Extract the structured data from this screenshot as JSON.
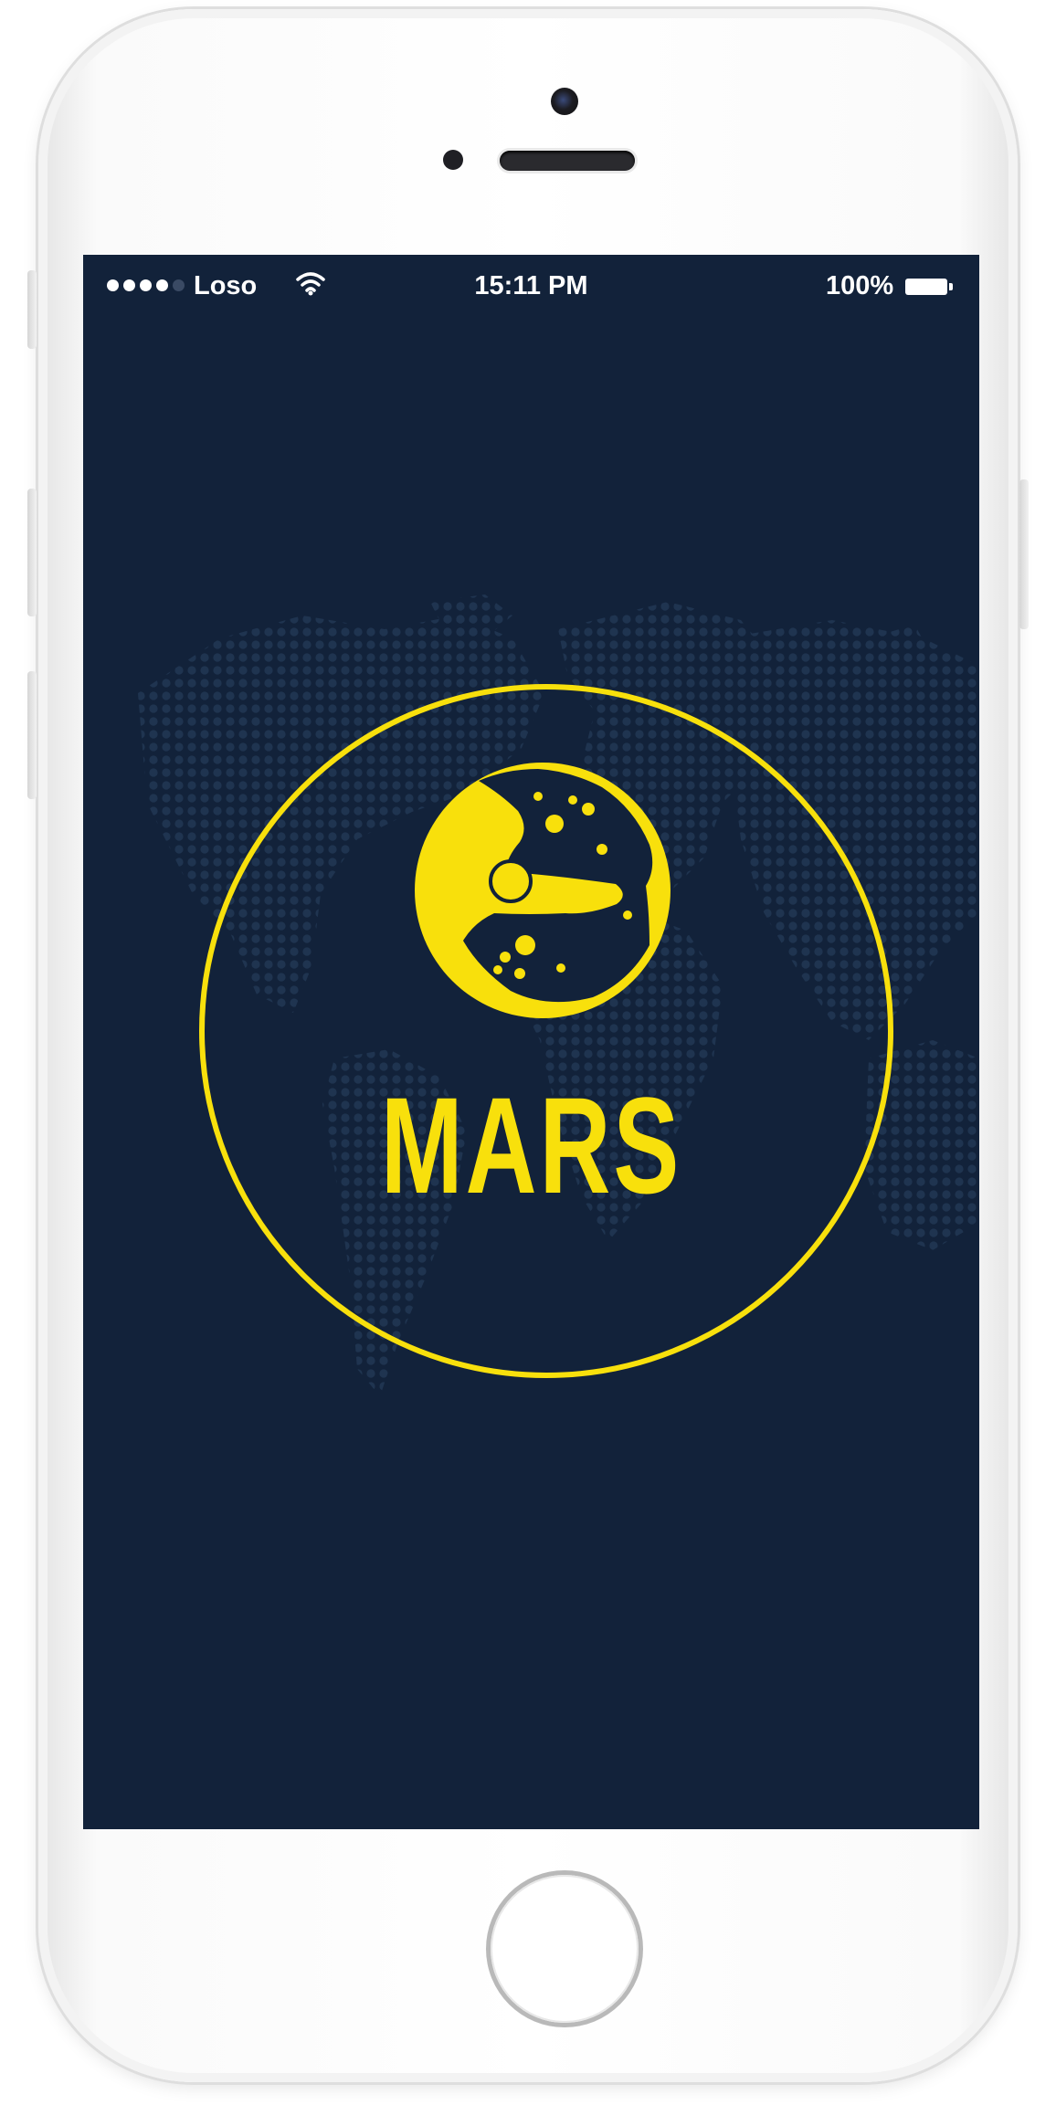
{
  "status_bar": {
    "carrier": "Loso",
    "time": "15:11 PM",
    "battery_percent": "100%",
    "signal_bars_filled": 4,
    "signal_bars_total": 5
  },
  "splash": {
    "app_name": "MARS",
    "logo_icon": "mars-planet-icon",
    "background_icon": "dotted-world-map"
  },
  "colors": {
    "background": "#12223a",
    "accent": "#f8e00c",
    "map_dots": "#1f3450",
    "status_text": "#ffffff"
  }
}
